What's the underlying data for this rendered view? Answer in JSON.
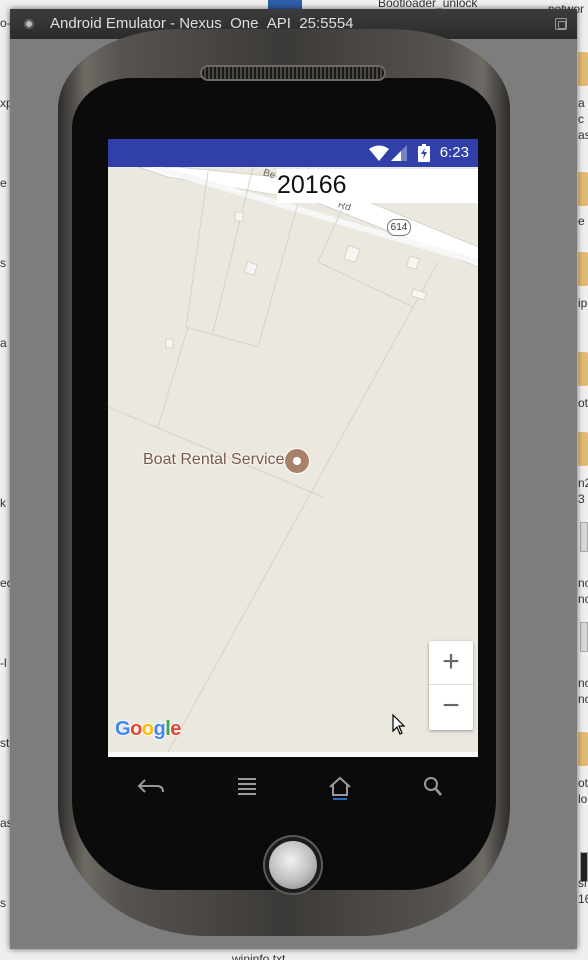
{
  "window": {
    "title": "Android Emulator - Nexus_One_API_25:5554"
  },
  "status_bar": {
    "time": "6:23",
    "icons": [
      "wifi-icon",
      "signal-icon",
      "battery-icon"
    ]
  },
  "app": {
    "zip_code": "20166"
  },
  "map": {
    "poi_label": "Boat Rental Service",
    "road_shield": "614",
    "road_fragments": [
      "Be",
      "Rd"
    ],
    "zoom_in_label": "+",
    "zoom_out_label": "−",
    "attribution": "Google"
  },
  "nav_keys": [
    "back-icon",
    "menu-icon",
    "home-icon",
    "search-icon"
  ],
  "desktop": {
    "fragments_top": [
      "o-",
      "Bootloader_unlock",
      "networ"
    ],
    "fragments_left": [
      "xp",
      "e",
      "s",
      "a",
      "k",
      "ec",
      "-l",
      "st",
      "as",
      "s"
    ],
    "fragments_right": [
      "a",
      "c",
      "as",
      "e",
      "ip",
      "ot",
      "n2",
      "3",
      "no",
      "nc",
      "no",
      "no",
      "ot",
      "lo",
      "si",
      "16"
    ],
    "fragments_bottom": [
      "wininfo.txt"
    ]
  },
  "colors": {
    "status_bar": "#3140a8",
    "map_background": "#ebe8df",
    "poi": "#a7816a"
  }
}
